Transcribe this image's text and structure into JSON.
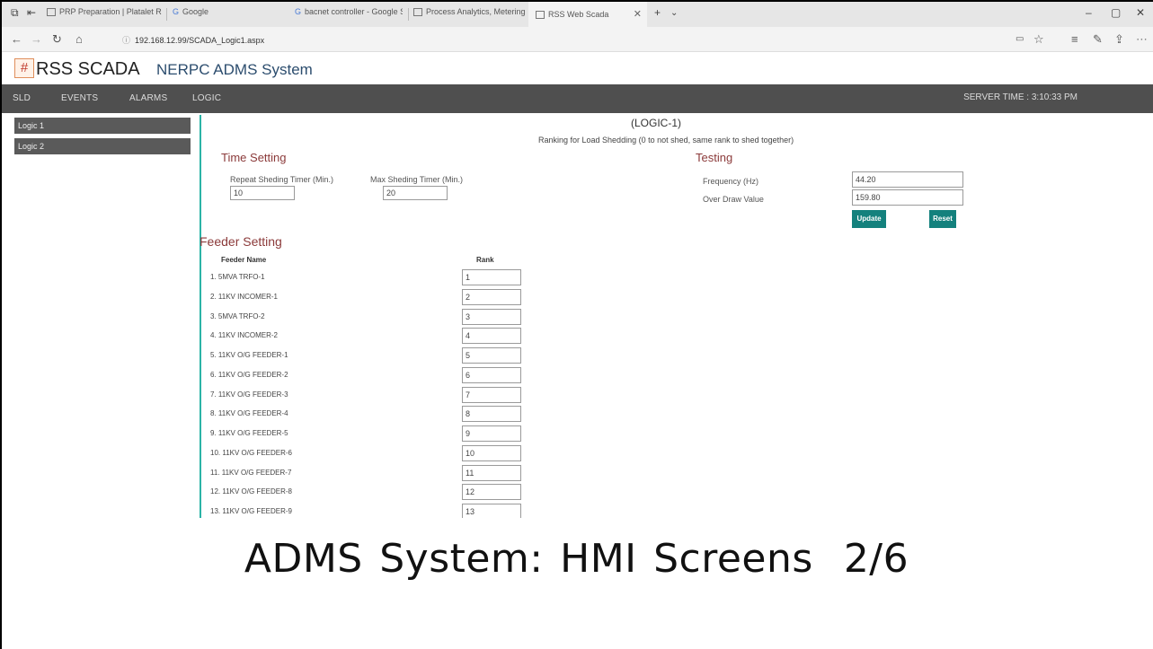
{
  "browser": {
    "tabs": [
      {
        "label": "PRP Preparation | Platalet R"
      },
      {
        "label": "Google"
      },
      {
        "label": "bacnet controller - Google S"
      },
      {
        "label": "Process Analytics, Metering"
      },
      {
        "label": "RSS Web Scada"
      }
    ],
    "url": "192.168.12.99/SCADA_Logic1.aspx"
  },
  "app": {
    "brand": "RSS SCADA",
    "system": "NERPC ADMS System",
    "logo_glyph": "#"
  },
  "menu": {
    "items": [
      "SLD",
      "EVENTS",
      "ALARMS",
      "LOGIC"
    ],
    "server_time": "SERVER TIME : 3:10:33 PM"
  },
  "sidebar": {
    "items": [
      "Logic 1",
      "Logic 2"
    ]
  },
  "content": {
    "title": "(LOGIC-1)",
    "subtitle": "Ranking for Load Shedding (0 to not shed, same rank to shed together)",
    "time_setting": {
      "heading": "Time Setting",
      "repeat_label": "Repeat Sheding Timer (Min.)",
      "repeat_value": "10",
      "max_label": "Max Sheding Timer (Min.)",
      "max_value": "20"
    },
    "testing": {
      "heading": "Testing",
      "frequency_label": "Frequency (Hz)",
      "frequency_value": "44.20",
      "overdraw_label": "Over Draw Value",
      "overdraw_value": "159.80",
      "update_label": "Update",
      "reset_label": "Reset"
    },
    "feeder_setting": {
      "heading": "Feeder Setting",
      "col_name": "Feeder Name",
      "col_rank": "Rank",
      "rows": [
        {
          "name": "1. 5MVA TRFO-1",
          "rank": "1"
        },
        {
          "name": "2. 11KV INCOMER-1",
          "rank": "2"
        },
        {
          "name": "3. 5MVA TRFO-2",
          "rank": "3"
        },
        {
          "name": "4. 11KV INCOMER-2",
          "rank": "4"
        },
        {
          "name": "5. 11KV O/G FEEDER-1",
          "rank": "5"
        },
        {
          "name": "6. 11KV O/G FEEDER-2",
          "rank": "6"
        },
        {
          "name": "7. 11KV O/G FEEDER-3",
          "rank": "7"
        },
        {
          "name": "8. 11KV O/G FEEDER-4",
          "rank": "8"
        },
        {
          "name": "9. 11KV O/G FEEDER-5",
          "rank": "9"
        },
        {
          "name": "10. 11KV O/G FEEDER-6",
          "rank": "10"
        },
        {
          "name": "11. 11KV O/G FEEDER-7",
          "rank": "11"
        },
        {
          "name": "12. 11KV O/G FEEDER-8",
          "rank": "12"
        },
        {
          "name": "13. 11KV O/G FEEDER-9",
          "rank": "13"
        }
      ]
    }
  },
  "caption": {
    "text": "ADMS System: HMI Screens",
    "page": "2/6"
  },
  "colors": {
    "menu_bg": "#4f4f4f",
    "accent_teal": "#14817d",
    "section_heading": "#8b3a3a",
    "divider": "#2bb3a6"
  }
}
